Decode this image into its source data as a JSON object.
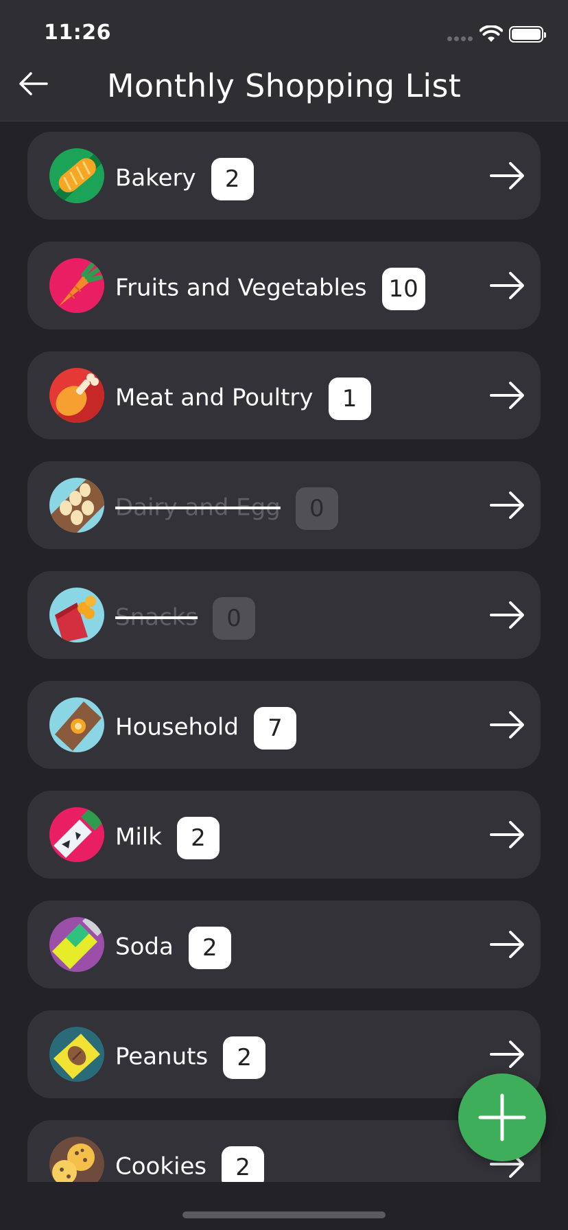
{
  "status_bar": {
    "time": "11:26"
  },
  "header": {
    "title": "Monthly Shopping List",
    "back_icon": "arrow-left-icon"
  },
  "categories": [
    {
      "label": "Bakery",
      "count": "2",
      "completed": false,
      "icon": "bread-icon",
      "icon_bg": "#1ba358"
    },
    {
      "label": "Fruits and Vegetables",
      "count": "10",
      "completed": false,
      "icon": "carrot-icon",
      "icon_bg": "#e91e63"
    },
    {
      "label": "Meat and Poultry",
      "count": "1",
      "completed": false,
      "icon": "chicken-leg-icon",
      "icon_bg": "#e53935"
    },
    {
      "label": "Dairy and Egg",
      "count": "0",
      "completed": true,
      "icon": "eggs-icon",
      "icon_bg": "#8ad6e4"
    },
    {
      "label": "Snacks",
      "count": "0",
      "completed": true,
      "icon": "chips-icon",
      "icon_bg": "#8ad6e4"
    },
    {
      "label": "Household",
      "count": "7",
      "completed": false,
      "icon": "household-icon",
      "icon_bg": "#8ad6e4"
    },
    {
      "label": "Milk",
      "count": "2",
      "completed": false,
      "icon": "milk-bottle-icon",
      "icon_bg": "#e91e63"
    },
    {
      "label": "Soda",
      "count": "2",
      "completed": false,
      "icon": "soda-can-icon",
      "icon_bg": "#9c4fa8"
    },
    {
      "label": "Peanuts",
      "count": "2",
      "completed": false,
      "icon": "peanuts-pack-icon",
      "icon_bg": "#2a6b7a"
    },
    {
      "label": "Cookies",
      "count": "2",
      "completed": false,
      "icon": "cookies-icon",
      "icon_bg": "#6d4c3d"
    }
  ],
  "fab": {
    "icon": "plus-icon",
    "color": "#3fae5b"
  },
  "colors": {
    "background": "#222227",
    "card": "#323238",
    "header": "#2e2e33",
    "badge": "#ffffff",
    "badge_done": "#505056"
  }
}
